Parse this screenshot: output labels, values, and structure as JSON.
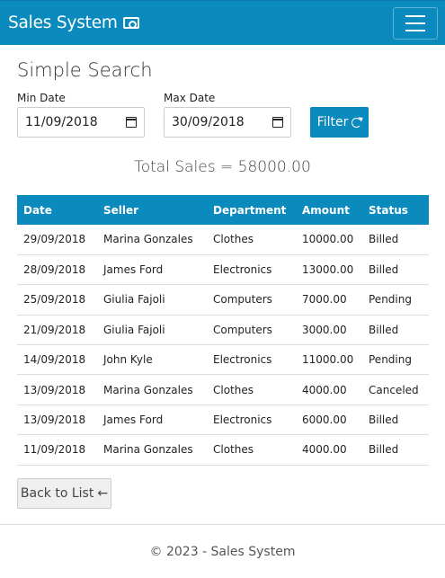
{
  "app": {
    "brand": "Sales System"
  },
  "page": {
    "title": "Simple Search"
  },
  "filters": {
    "min_label": "Min Date",
    "min_value": "11/09/2018",
    "max_label": "Max Date",
    "max_value": "30/09/2018",
    "filter_label": "Filter"
  },
  "summary": {
    "total": "Total Sales = 58000.00"
  },
  "table": {
    "headers": [
      "Date",
      "Seller",
      "Department",
      "Amount",
      "Status"
    ],
    "rows": [
      [
        "29/09/2018",
        "Marina Gonzales",
        "Clothes",
        "10000.00",
        "Billed"
      ],
      [
        "28/09/2018",
        "James Ford",
        "Electronics",
        "13000.00",
        "Billed"
      ],
      [
        "25/09/2018",
        "Giulia Fajoli",
        "Computers",
        "7000.00",
        "Pending"
      ],
      [
        "21/09/2018",
        "Giulia Fajoli",
        "Computers",
        "3000.00",
        "Billed"
      ],
      [
        "14/09/2018",
        "John Kyle",
        "Electronics",
        "11000.00",
        "Pending"
      ],
      [
        "13/09/2018",
        "Marina Gonzales",
        "Clothes",
        "4000.00",
        "Canceled"
      ],
      [
        "13/09/2018",
        "James Ford",
        "Electronics",
        "6000.00",
        "Billed"
      ],
      [
        "11/09/2018",
        "Marina Gonzales",
        "Clothes",
        "4000.00",
        "Billed"
      ]
    ]
  },
  "actions": {
    "back_label": "Back to List"
  },
  "footer": {
    "text": "© 2023 - Sales System"
  },
  "colors": {
    "primary": "#0a8abd"
  },
  "icons": {
    "brand": "money-bill-icon",
    "filter": "refresh-icon",
    "back": "arrow-left-icon",
    "menu": "hamburger-icon",
    "date": "calendar-icon"
  }
}
